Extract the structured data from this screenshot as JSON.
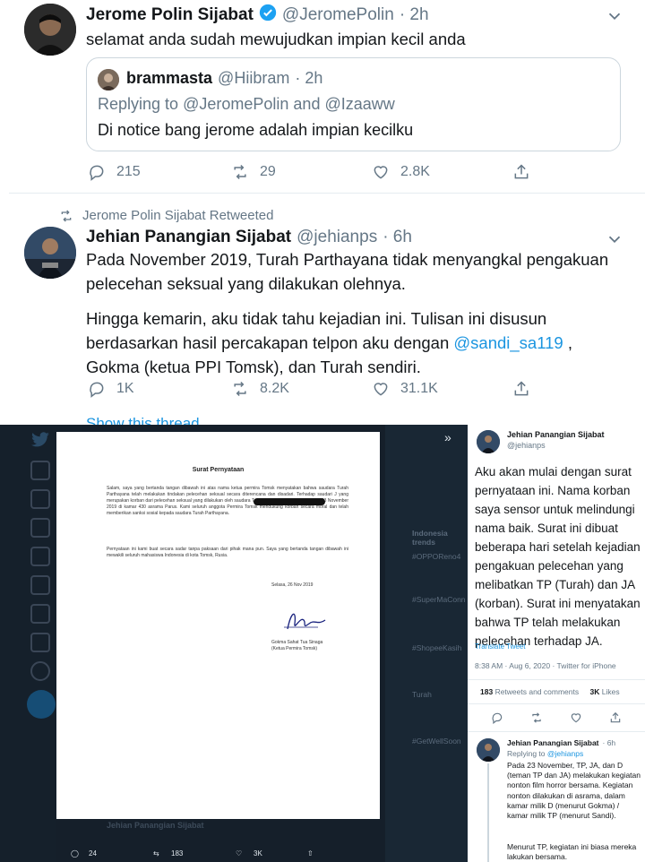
{
  "tweet1": {
    "name": "Jerome Polin Sijabat",
    "handle": "@JeromePolin",
    "time": "· 2h",
    "text": "selamat anda sudah mewujudkan impian kecil anda",
    "quote": {
      "name": "brammasta",
      "handle": "@Hiibram",
      "time": "· 2h",
      "reply_prefix": "Replying to",
      "reply_to_1": "@JeromePolin",
      "reply_and": "and",
      "reply_to_2": "@Izaaww",
      "text": "Di notice bang jerome adalah impian kecilku"
    },
    "replies": "215",
    "retweets": "29",
    "likes": "2.8K"
  },
  "tweet2": {
    "retweeted_by": "Jerome Polin Sijabat Retweeted",
    "name": "Jehian Panangian Sijabat",
    "handle": "@jehianps",
    "time": "· 6h",
    "para1": "Pada November 2019, Turah Parthayana tidak menyangkal pengakuan pelecehan seksual yang dilakukan olehnya.",
    "para2_a": "Hingga kemarin, aku tidak tahu kejadian ini. Tulisan ini disusun berdasarkan hasil percakapan telpon aku dengan ",
    "para2_link": "@sandi_sa119",
    "para2_b": " , Gokma (ketua PPI Tomsk), dan Turah sendiri.",
    "replies": "1K",
    "retweets": "8.2K",
    "likes": "31.1K",
    "show_thread": "Show this thread"
  },
  "letter": {
    "title": "Surat Pernyataan",
    "para1": "Salam, saya yang bertanda tangan dibawah ini atas nama ketua permira Tomsk menyatakan bahwa saudara Turah Parthayana telah melakukan tindakan pelecehan seksual secara diterencana dan disadari. Terhadap saudari J yang merupakan korban dari pelecehan seksual yang dilakukan oleh saudara Turah Parthayana pada hari sabtu 23 November 2019 di kamar 430 asrama Parus. Kami seluruh anggota Permira Tomsk mendukung korban secara moral dan telah memberikan sanksi sosial kepada saudara Turah Parthayana.",
    "para2": "Pernyataan ini kami buat secara sadar tanpa paksaan dari pihak mana pun. Saya yang bertanda tangan dibawah ini mewakili seluruh mahasiswa Indonesia di kota Tomsk, Rusia.",
    "date": "Selasa, 26 Nov 2019",
    "signer": "Gokma Sahat Tua Sinaga",
    "signer_role": "(Ketua Permira Tomsk)"
  },
  "dark_sidebar": {
    "items": [
      "Indonesia trends",
      "#OPPOReno4",
      "#SuperMaConn",
      "#ShopeeKasih",
      "Turah",
      "#GetWellSoon"
    ]
  },
  "panel": {
    "name": "Jehian Panangian Sijabat",
    "handle": "@jehianps",
    "text": "Aku akan mulai dengan surat pernyataan ini. Nama korban saya sensor untuk melindungi nama baik. Surat ini dibuat beberapa hari setelah kejadian pengakuan pelecehan yang melibatkan TP (Turah) dan JA (korban). Surat ini menyatakan bahwa TP telah melakukan pelecehan terhadap JA.",
    "translate": "Translate Tweet",
    "meta": "8:38 AM · Aug 6, 2020 · Twitter for iPhone",
    "rt_count": "183",
    "rt_label": "Retweets and comments",
    "like_count": "3K",
    "like_label": "Likes",
    "reply": {
      "name": "Jehian Panangian Sijabat",
      "time": "· 6h",
      "replying": "Replying to",
      "replying_to": "@jehianps",
      "text1": "Pada 23 November, TP, JA, dan D (teman TP dan JA) melakukan kegiatan nonton film horror bersama. Kegiatan nonton dilakukan di asrama, dalam kamar milik D (menurut Gokma) / kamar milik TP (menurut Sandi).",
      "text2": "Menurut TP, kegiatan ini biasa mereka lakukan bersama."
    }
  },
  "bottom_bar": {
    "name": "Jehian Panangian Sijabat",
    "replies": "24",
    "retweets": "183",
    "likes": "3K"
  }
}
